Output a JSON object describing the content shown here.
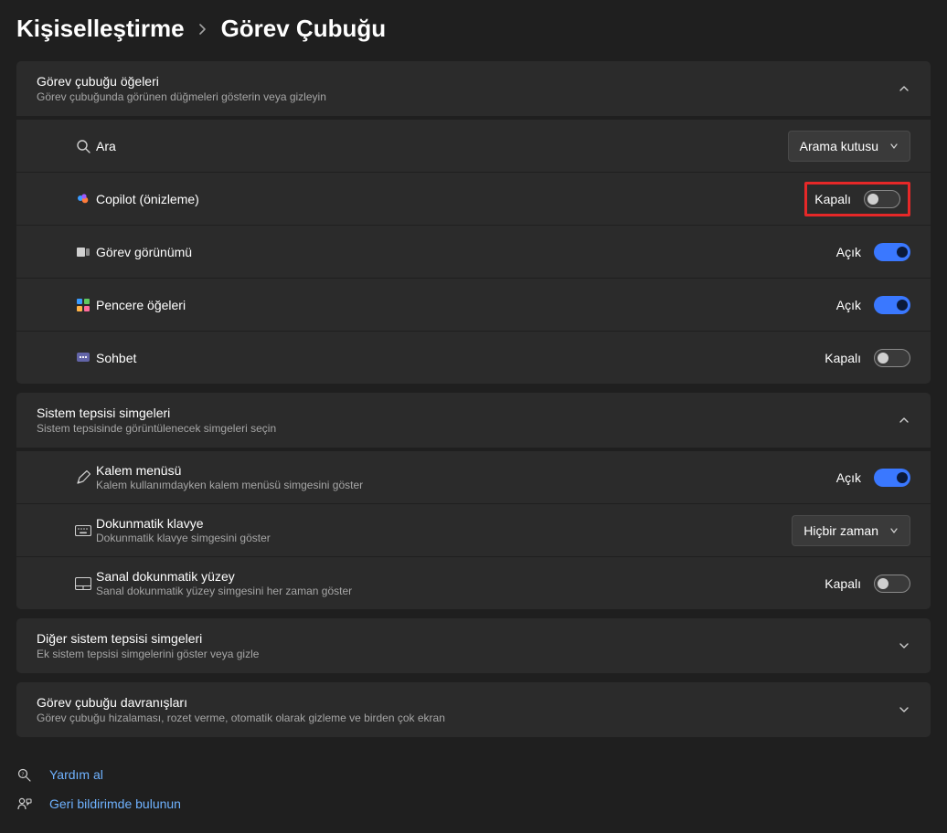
{
  "breadcrumb": {
    "parent": "Kişiselleştirme",
    "current": "Görev Çubuğu"
  },
  "sections": {
    "taskbar_items": {
      "title": "Görev çubuğu öğeleri",
      "subtitle": "Görev çubuğunda görünen düğmeleri gösterin veya gizleyin"
    },
    "tray_icons": {
      "title": "Sistem tepsisi simgeleri",
      "subtitle": "Sistem tepsisinde görüntülenecek simgeleri seçin"
    },
    "other_tray": {
      "title": "Diğer sistem tepsisi simgeleri",
      "subtitle": "Ek sistem tepsisi simgelerini göster veya gizle"
    },
    "behaviors": {
      "title": "Görev çubuğu davranışları",
      "subtitle": "Görev çubuğu hizalaması, rozet verme, otomatik olarak gizleme ve birden çok ekran"
    }
  },
  "items": {
    "search": {
      "label": "Ara",
      "dropdown": "Arama kutusu"
    },
    "copilot": {
      "label": "Copilot (önizleme)",
      "state_label": "Kapalı",
      "state": "off"
    },
    "taskview": {
      "label": "Görev görünümü",
      "state_label": "Açık",
      "state": "on"
    },
    "widgets": {
      "label": "Pencere öğeleri",
      "state_label": "Açık",
      "state": "on"
    },
    "chat": {
      "label": "Sohbet",
      "state_label": "Kapalı",
      "state": "off"
    },
    "pen": {
      "label": "Kalem menüsü",
      "sublabel": "Kalem kullanımdayken kalem menüsü simgesini göster",
      "state_label": "Açık",
      "state": "on"
    },
    "touchkb": {
      "label": "Dokunmatik klavye",
      "sublabel": "Dokunmatik klavye simgesini göster",
      "dropdown": "Hiçbir zaman"
    },
    "touchpad": {
      "label": "Sanal dokunmatik yüzey",
      "sublabel": "Sanal dokunmatik yüzey simgesini her zaman göster",
      "state_label": "Kapalı",
      "state": "off"
    }
  },
  "links": {
    "help": "Yardım al",
    "feedback": "Geri bildirimde bulunun"
  }
}
